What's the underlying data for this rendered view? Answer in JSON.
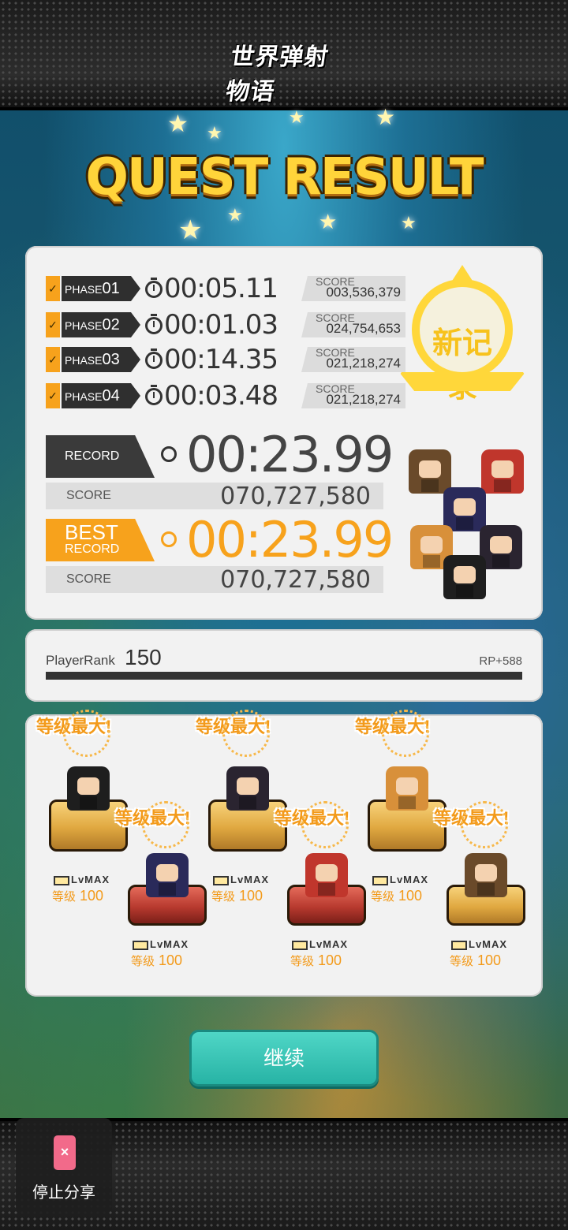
{
  "logo": {
    "text": "世界弹射物语"
  },
  "title": "QUEST RESULT",
  "phases": [
    {
      "label": "PHASE",
      "num": "01",
      "time": "00:05.11",
      "score_label": "SCORE",
      "score": "003,536,379"
    },
    {
      "label": "PHASE",
      "num": "02",
      "time": "00:01.03",
      "score_label": "SCORE",
      "score": "024,754,653"
    },
    {
      "label": "PHASE",
      "num": "03",
      "time": "00:14.35",
      "score_label": "SCORE",
      "score": "021,218,274"
    },
    {
      "label": "PHASE",
      "num": "04",
      "time": "00:03.48",
      "score_label": "SCORE",
      "score": "021,218,274"
    }
  ],
  "stamp": {
    "text": "新记录"
  },
  "record": {
    "label": "RECORD",
    "time": "00:23.99",
    "score_label": "SCORE",
    "score": "070,727,580"
  },
  "best_record": {
    "label_line1": "BEST",
    "label_line2": "RECORD",
    "time": "00:23.99",
    "score_label": "SCORE",
    "score": "070,727,580"
  },
  "player_rank": {
    "label": "PlayerRank",
    "value": "150",
    "rp": "RP+588",
    "progress": 1.0
  },
  "level_units": [
    {
      "burst": "等级最大!",
      "lvmax": "LvMAX",
      "level_label": "等级",
      "level": "100"
    },
    {
      "burst": "等级最大!",
      "lvmax": "LvMAX",
      "level_label": "等级",
      "level": "100"
    },
    {
      "burst": "等级最大!",
      "lvmax": "LvMAX",
      "level_label": "等级",
      "level": "100"
    },
    {
      "burst": "等级最大!",
      "lvmax": "LvMAX",
      "level_label": "等级",
      "level": "100"
    },
    {
      "burst": "等级最大!",
      "lvmax": "LvMAX",
      "level_label": "等级",
      "level": "100"
    },
    {
      "burst": "等级最大!",
      "lvmax": "LvMAX",
      "level_label": "等级",
      "level": "100"
    }
  ],
  "continue_label": "继续",
  "stop_share": {
    "label": "停止分享"
  },
  "colors": {
    "accent_orange": "#f7a21c",
    "continue_teal": "#2fc0b0",
    "stamp_yellow": "#ffd73a"
  }
}
